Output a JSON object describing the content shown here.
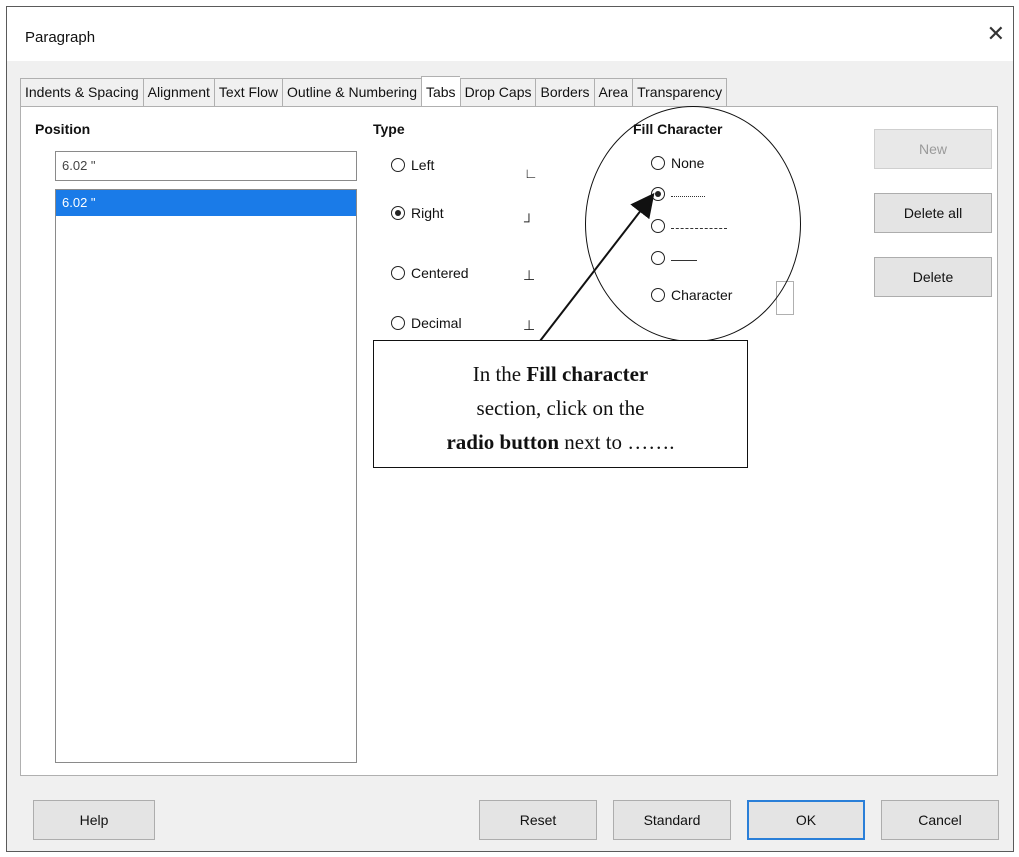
{
  "window": {
    "title": "Paragraph",
    "close_glyph": "✕"
  },
  "tabs": [
    {
      "label": "Indents & Spacing"
    },
    {
      "label": "Alignment"
    },
    {
      "label": "Text Flow"
    },
    {
      "label": "Outline & Numbering"
    },
    {
      "label": "Tabs",
      "active": true
    },
    {
      "label": "Drop Caps"
    },
    {
      "label": "Borders"
    },
    {
      "label": "Area"
    },
    {
      "label": "Transparency"
    }
  ],
  "position": {
    "header": "Position",
    "input_value": "6.02 \"",
    "list": [
      "6.02 \""
    ]
  },
  "type": {
    "header": "Type",
    "options": [
      {
        "label": "Left",
        "selected": false
      },
      {
        "label": "Right",
        "selected": true
      },
      {
        "label": "Centered",
        "selected": false
      },
      {
        "label": "Decimal",
        "selected": false
      }
    ]
  },
  "fill": {
    "header": "Fill Character",
    "none_label": "None",
    "character_label": "Character",
    "selected": "dotted"
  },
  "buttons": {
    "new": "New",
    "delete_all": "Delete all",
    "delete": "Delete",
    "help": "Help",
    "reset": "Reset",
    "standard": "Standard",
    "ok": "OK",
    "cancel": "Cancel"
  },
  "callout": {
    "t1": "In the ",
    "b1": "Fill character",
    "t2": "section, click on the ",
    "b2": "radio button",
    "t3": " next to ……."
  }
}
